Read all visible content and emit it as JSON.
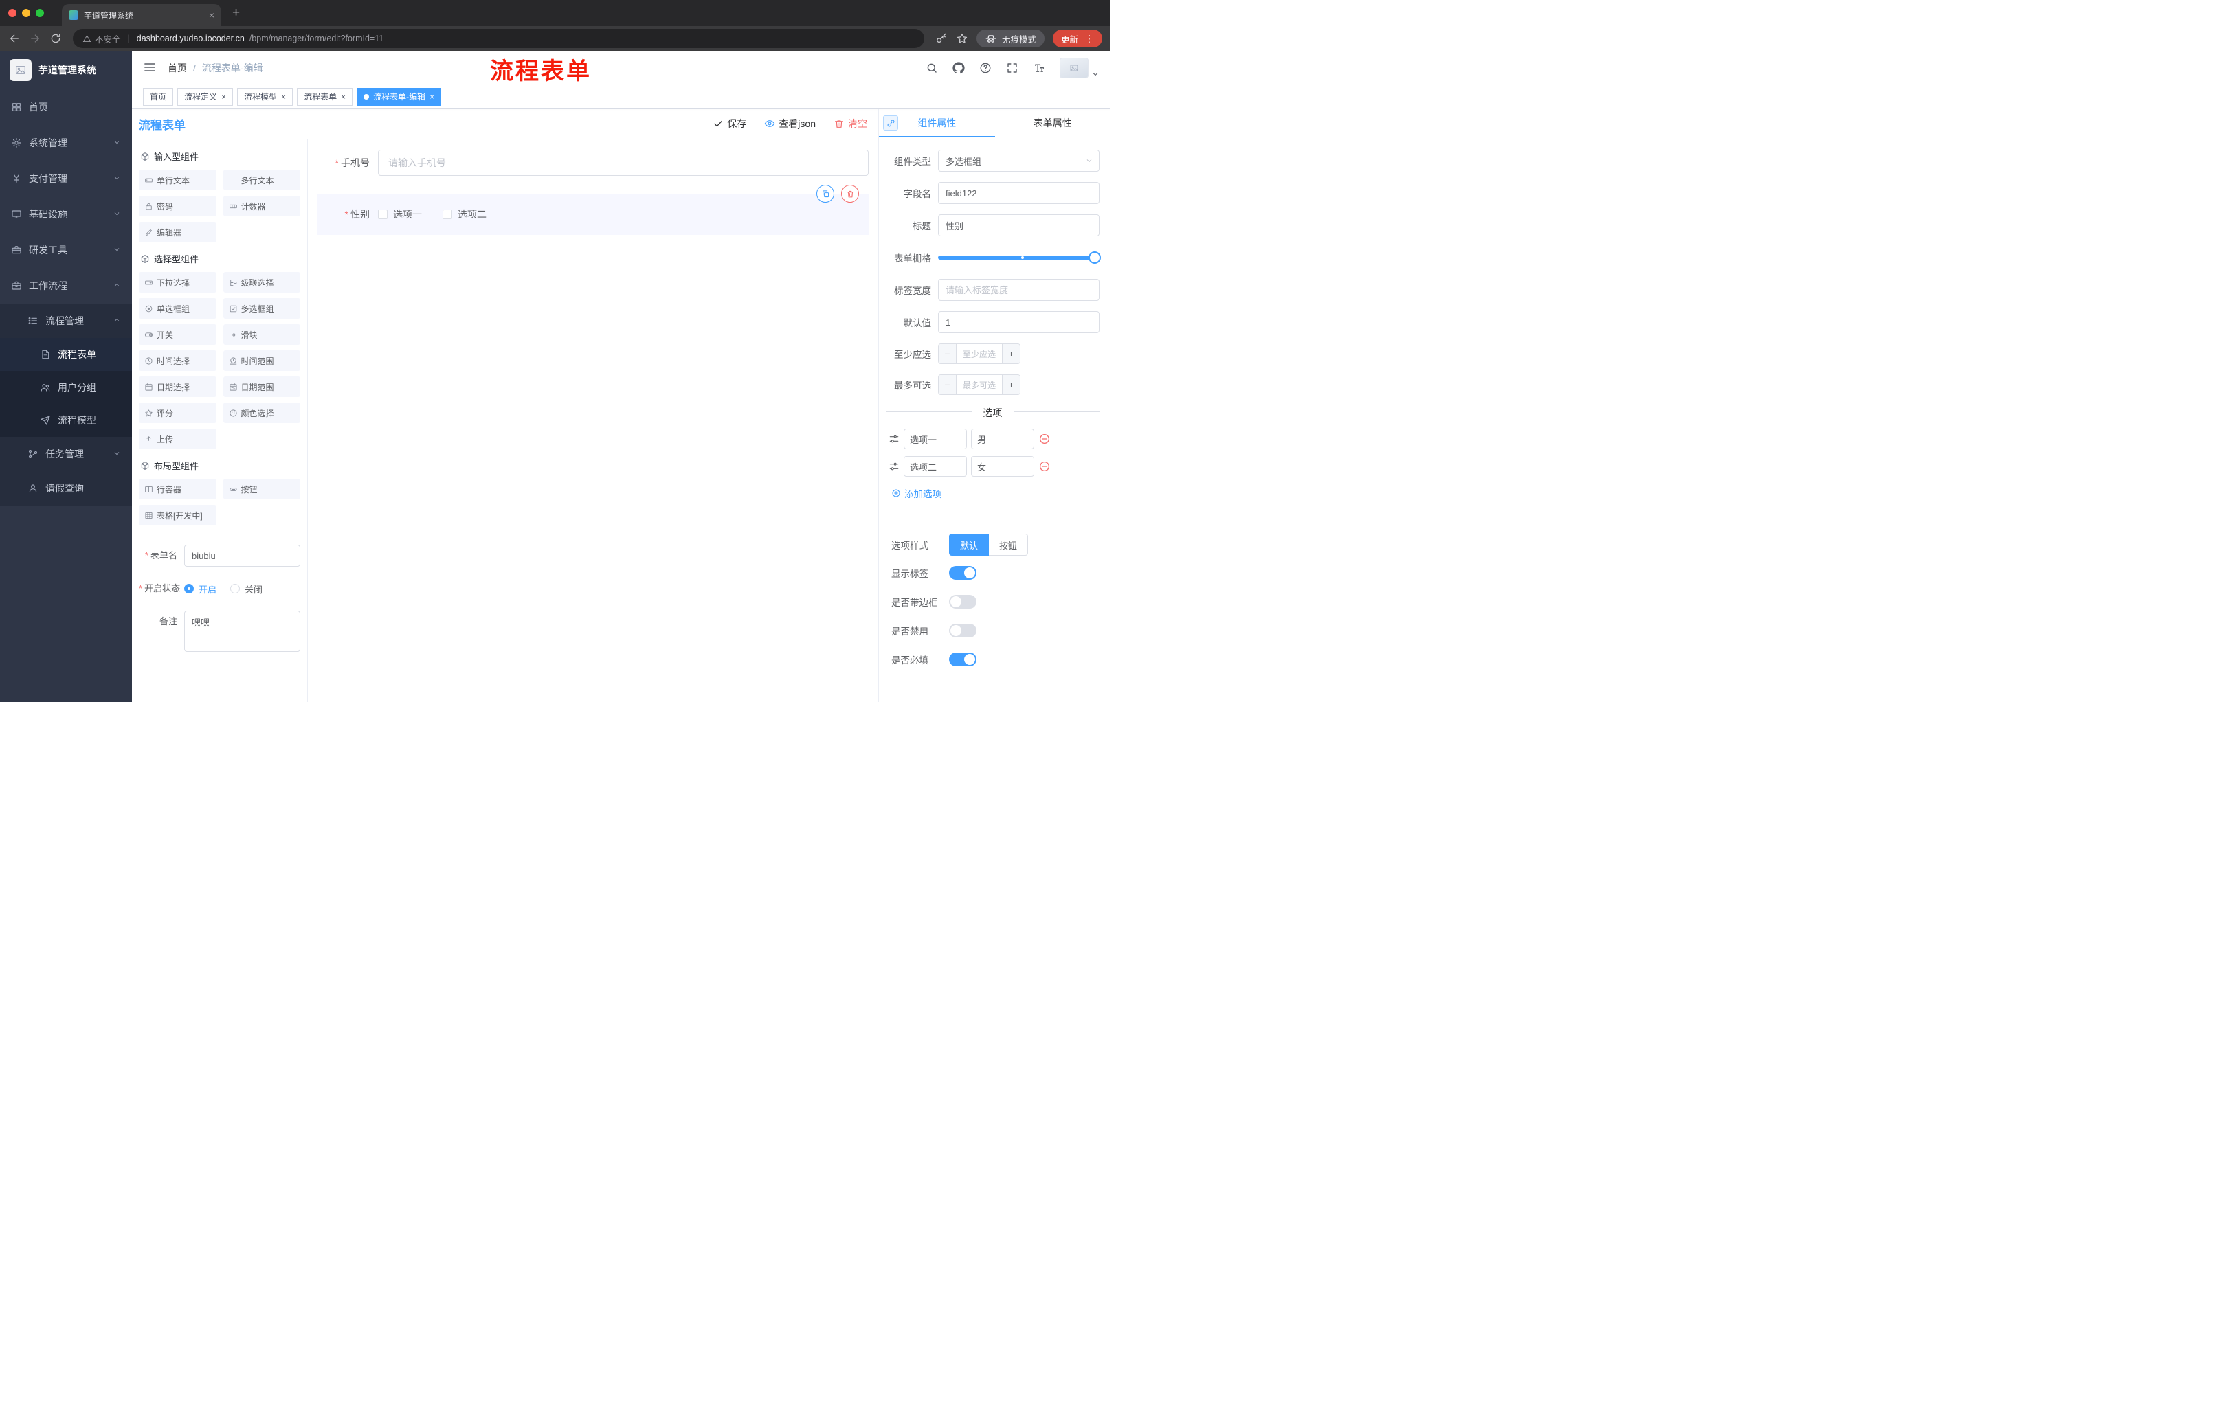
{
  "glyphs": {
    "close": "×",
    "plus": "+",
    "minus": "−",
    "kebab": "⋮",
    "pipe": "|"
  },
  "colors": {
    "accent": "#409eff",
    "danger": "#f56c6c",
    "sidebar_bg": "#2f3647",
    "annotation": "#f51d0b",
    "update_pill": "#d9483b"
  },
  "browser": {
    "tab_title": "芋道管理系统",
    "security_label": "不安全",
    "url_domain": "dashboard.yudao.iocoder.cn",
    "url_path": "/bpm/manager/form/edit?formId=11",
    "incognito_label": "无痕模式",
    "update_label": "更新"
  },
  "sidebar": {
    "logo_title": "芋道管理系统",
    "items": [
      {
        "label": "首页",
        "icon": "dashboard-icon"
      },
      {
        "label": "系统管理",
        "icon": "gear-icon",
        "chevron": "down"
      },
      {
        "label": "支付管理",
        "icon": "yen-icon",
        "chevron": "down"
      },
      {
        "label": "基础设施",
        "icon": "monitor-icon",
        "chevron": "down"
      },
      {
        "label": "研发工具",
        "icon": "toolbox-icon",
        "chevron": "down"
      },
      {
        "label": "工作流程",
        "icon": "briefcase-icon",
        "chevron": "up",
        "expanded": true
      }
    ],
    "workflow_children": [
      {
        "label": "流程管理",
        "icon": "list-icon",
        "chevron": "up",
        "expanded": true,
        "children": [
          {
            "label": "流程表单",
            "icon": "document-icon",
            "active": true
          },
          {
            "label": "用户分组",
            "icon": "users-icon"
          },
          {
            "label": "流程模型",
            "icon": "send-icon"
          }
        ]
      },
      {
        "label": "任务管理",
        "icon": "branch-icon",
        "chevron": "down"
      },
      {
        "label": "请假查询",
        "icon": "user-icon"
      }
    ]
  },
  "navbar": {
    "breadcrumb": {
      "root": "首页",
      "separator": "/",
      "current": "流程表单-编辑"
    },
    "annotation": "流程表单"
  },
  "tags": [
    {
      "label": "首页",
      "closable": false,
      "active": false
    },
    {
      "label": "流程定义",
      "closable": true,
      "active": false
    },
    {
      "label": "流程模型",
      "closable": true,
      "active": false
    },
    {
      "label": "流程表单",
      "closable": true,
      "active": false
    },
    {
      "label": "流程表单-编辑",
      "closable": true,
      "active": true
    }
  ],
  "designer": {
    "title": "流程表单",
    "actions": {
      "save": "保存",
      "view_json": "查看json",
      "clear": "清空"
    },
    "component_groups": [
      {
        "title": "输入型组件",
        "items": [
          {
            "label": "单行文本",
            "icon": "input-icon"
          },
          {
            "label": "多行文本",
            "icon": "textarea-icon"
          },
          {
            "label": "密码",
            "icon": "lock-icon"
          },
          {
            "label": "计数器",
            "icon": "counter-icon"
          },
          {
            "label": "编辑器",
            "icon": "editor-icon"
          }
        ]
      },
      {
        "title": "选择型组件",
        "items": [
          {
            "label": "下拉选择",
            "icon": "select-icon"
          },
          {
            "label": "级联选择",
            "icon": "cascader-icon"
          },
          {
            "label": "单选框组",
            "icon": "radio-icon"
          },
          {
            "label": "多选框组",
            "icon": "checkbox-icon"
          },
          {
            "label": "开关",
            "icon": "switch-icon"
          },
          {
            "label": "滑块",
            "icon": "slider-icon"
          },
          {
            "label": "时间选择",
            "icon": "time-icon"
          },
          {
            "label": "时间范围",
            "icon": "time-range-icon"
          },
          {
            "label": "日期选择",
            "icon": "date-icon"
          },
          {
            "label": "日期范围",
            "icon": "date-range-icon"
          },
          {
            "label": "评分",
            "icon": "rate-icon"
          },
          {
            "label": "颜色选择",
            "icon": "color-icon"
          },
          {
            "label": "上传",
            "icon": "upload-icon"
          }
        ]
      },
      {
        "title": "布局型组件",
        "items": [
          {
            "label": "行容器",
            "icon": "row-icon"
          },
          {
            "label": "按钮",
            "icon": "button-icon"
          },
          {
            "label": "表格[开发中]",
            "icon": "table-icon"
          }
        ]
      }
    ],
    "meta_form": {
      "name_label": "表单名",
      "name_value": "biubiu",
      "status_label": "开启状态",
      "status_options": [
        {
          "label": "开启",
          "selected": true
        },
        {
          "label": "关闭",
          "selected": false
        }
      ],
      "remark_label": "备注",
      "remark_value": "嘿嘿"
    },
    "canvas": {
      "phone_field": {
        "label": "手机号",
        "required": true,
        "placeholder": "请输入手机号"
      },
      "gender_field": {
        "label": "性别",
        "required": true,
        "type": "checkbox-group",
        "selected": true,
        "options": [
          "选项一",
          "选项二"
        ]
      }
    },
    "properties": {
      "tabs": [
        {
          "label": "组件属性",
          "active": true
        },
        {
          "label": "表单属性",
          "active": false
        }
      ],
      "component_type": {
        "label": "组件类型",
        "value": "多选框组"
      },
      "field_name": {
        "label": "字段名",
        "value": "field122"
      },
      "title": {
        "label": "标题",
        "value": "性别"
      },
      "grid": {
        "label": "表单栅格"
      },
      "label_width": {
        "label": "标签宽度",
        "placeholder": "请输入标签宽度"
      },
      "default_value": {
        "label": "默认值",
        "value": "1"
      },
      "min_select": {
        "label": "至少应选",
        "placeholder": "至少应选"
      },
      "max_select": {
        "label": "最多可选",
        "placeholder": "最多可选"
      },
      "options_divider": "选项",
      "options": [
        {
          "label": "选项一",
          "value": "男"
        },
        {
          "label": "选项二",
          "value": "女"
        }
      ],
      "add_option": "添加选项",
      "option_style": {
        "label": "选项样式",
        "options": [
          "默认",
          "按钮"
        ],
        "active": "默认"
      },
      "switches": [
        {
          "label": "显示标签",
          "on": true
        },
        {
          "label": "是否带边框",
          "on": false
        },
        {
          "label": "是否禁用",
          "on": false
        },
        {
          "label": "是否必填",
          "on": true
        }
      ]
    }
  }
}
